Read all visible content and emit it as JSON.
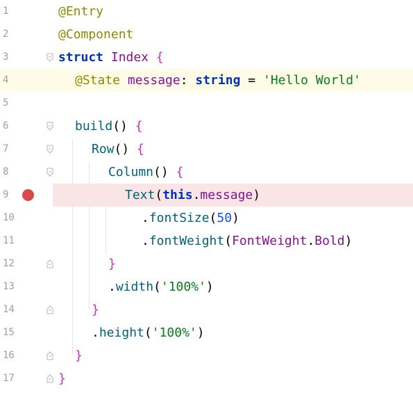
{
  "editor": {
    "colors": {
      "current_line": "#fefce6",
      "breakpoint_line": "#f9e5e5",
      "breakpoint_dot": "#d84a4a"
    },
    "lines": [
      {
        "num": "1",
        "code": "@Entry"
      },
      {
        "num": "2",
        "code": "@Component"
      },
      {
        "num": "3",
        "code": "struct Index {"
      },
      {
        "num": "4",
        "code": "@State message: string = 'Hello World'"
      },
      {
        "num": "5",
        "code": ""
      },
      {
        "num": "6",
        "code": "build() {"
      },
      {
        "num": "7",
        "code": "Row() {"
      },
      {
        "num": "8",
        "code": "Column() {"
      },
      {
        "num": "9",
        "code": "Text(this.message)"
      },
      {
        "num": "10",
        "code": ".fontSize(50)"
      },
      {
        "num": "11",
        "code": ".fontWeight(FontWeight.Bold)"
      },
      {
        "num": "12",
        "code": "}"
      },
      {
        "num": "13",
        "code": ".width('100%')"
      },
      {
        "num": "14",
        "code": "}"
      },
      {
        "num": "15",
        "code": ".height('100%')"
      },
      {
        "num": "16",
        "code": "}"
      },
      {
        "num": "17",
        "code": "}"
      }
    ]
  }
}
